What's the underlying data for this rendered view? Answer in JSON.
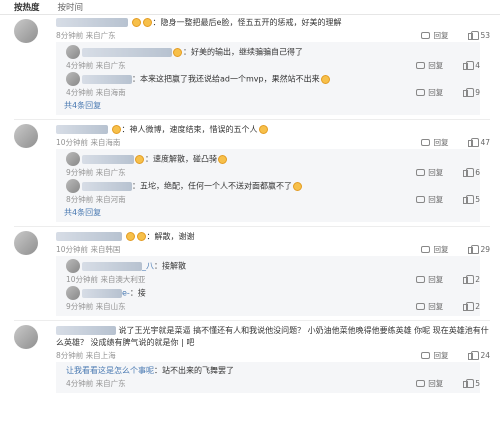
{
  "tabs": [
    "按热度",
    "按时间"
  ],
  "comments": [
    {
      "text": "隐身一整把最后e脸，怪五五开的惩戒，好美的理解",
      "time": "8分钟前",
      "location": "来自广东",
      "reply_label": "回复",
      "likes": "53",
      "replies": [
        {
          "text": "好美的输出，继续骗骗自己得了",
          "time": "4分钟前",
          "location": "来自广东",
          "reply_label": "回复",
          "likes": "4"
        },
        {
          "text": "本来这把赢了我还说给ad一个mvp，果然站不出来",
          "time": "4分钟前",
          "location": "来自海南",
          "reply_label": "回复",
          "likes": "9"
        }
      ],
      "more": "共4条回复"
    },
    {
      "text": "神人微博，速度结束，惜误的五个人",
      "time": "10分钟前",
      "location": "来自海南",
      "reply_label": "回复",
      "likes": "47",
      "replies": [
        {
          "text": "速度解散，碰凸骑",
          "time": "9分钟前",
          "location": "来自广东",
          "reply_label": "回复",
          "likes": "6"
        },
        {
          "text": "五坨，绝配，任何一个人不送对面都赢不了",
          "time": "8分钟前",
          "location": "来自河南",
          "reply_label": "回复",
          "likes": "5"
        }
      ],
      "more": "共4条回复"
    },
    {
      "text": "解散，谢谢",
      "time": "10分钟前",
      "location": "来自韩国",
      "reply_label": "回复",
      "likes": "29",
      "replies": [
        {
          "name": "_八",
          "text": "：接解散",
          "time": "10分钟前",
          "location": "来自澳大利亚",
          "reply_label": "回复",
          "likes": "2"
        },
        {
          "name": "e-",
          "text": "：接",
          "time": "9分钟前",
          "location": "来自山东",
          "reply_label": "回复",
          "likes": "2"
        }
      ],
      "more": ""
    },
    {
      "text": "说了王光宇就是菜逼 搞不懂还有人和我说他没问题？ 小奶油他菜他晚得他要练英雄 你呢 现在英雄池有什么英雄？ 没成绩有脾气说的就是你 | 吧",
      "time": "8分钟前",
      "location": "来自上海",
      "reply_label": "回复",
      "likes": "24",
      "replies": [
        {
          "link": "让我看看这是怎么个事呢",
          "text": "：站不出来的飞舞罢了",
          "time": "4分钟前",
          "location": "来自广东",
          "reply_label": "回复",
          "likes": "5"
        }
      ],
      "more": ""
    }
  ]
}
